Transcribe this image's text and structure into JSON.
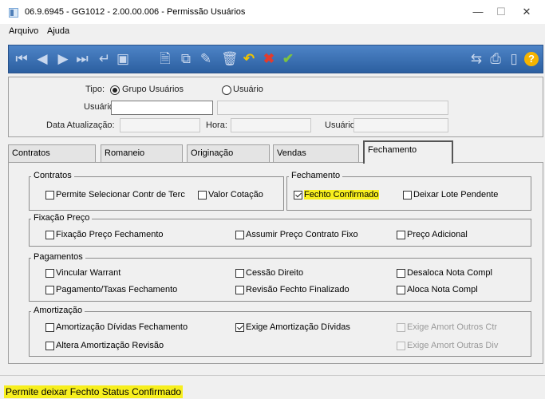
{
  "window": {
    "title": "06.9.6945 - GG1012 - 2.00.00.006 - Permissão Usuários",
    "minimize": "—",
    "maximize": "☐",
    "close": "✕"
  },
  "menu": [
    "Arquivo",
    "Ajuda"
  ],
  "toolbar": {
    "icons": [
      "first-record-icon",
      "prev-record-icon",
      "next-record-icon",
      "last-record-icon",
      "return-icon",
      "view-icon",
      "new-document-icon",
      "copy-icon",
      "edit-icon",
      "delete-icon",
      "undo-icon",
      "cancel-icon",
      "confirm-icon",
      "filter-icon",
      "print-icon",
      "exit-icon",
      "help-icon"
    ],
    "colors": {
      "undo": "#f0c300",
      "cancel": "#e43b2c",
      "confirm": "#7cc242",
      "help": "#f5b400"
    }
  },
  "header": {
    "tipo_label": "Tipo:",
    "radio_grupo": "Grupo Usuários",
    "radio_usuario": "Usuário",
    "radio_selected": "grupo",
    "usuario_label": "Usuário:",
    "usuario_value": "",
    "data_label": "Data Atualização:",
    "hora_label": "Hora:",
    "usuario2_label": "Usuário:"
  },
  "tabs": [
    {
      "label": "Contratos"
    },
    {
      "label": "Romaneio"
    },
    {
      "label": "Originação"
    },
    {
      "label": "Vendas"
    },
    {
      "label": "Fechamento",
      "active": true
    }
  ],
  "groups": {
    "contratos": {
      "title": "Contratos",
      "items": [
        {
          "label": "Permite Selecionar Contr de Terc",
          "checked": false
        },
        {
          "label": "Valor Cotação",
          "checked": false
        }
      ]
    },
    "fechamento": {
      "title": "Fechamento",
      "items": [
        {
          "label": "Fechto Confirmado",
          "checked": true,
          "highlight": true
        },
        {
          "label": "Deixar Lote Pendente",
          "checked": false
        }
      ]
    },
    "fixacao": {
      "title": "Fixação Preço",
      "items": [
        {
          "label": "Fixação Preço Fechamento",
          "checked": false
        },
        {
          "label": "Assumir Preço Contrato Fixo",
          "checked": false
        },
        {
          "label": "Preço Adicional",
          "checked": false
        }
      ]
    },
    "pagamentos": {
      "title": "Pagamentos",
      "items": [
        {
          "label": "Vincular Warrant",
          "checked": false
        },
        {
          "label": "Cessão Direito",
          "checked": false
        },
        {
          "label": "Desaloca Nota Compl",
          "checked": false
        },
        {
          "label": "Pagamento/Taxas Fechamento",
          "checked": false
        },
        {
          "label": "Revisão Fechto Finalizado",
          "checked": false
        },
        {
          "label": "Aloca Nota Compl",
          "checked": false
        }
      ]
    },
    "amortizacao": {
      "title": "Amortização",
      "items": [
        {
          "label": "Amortização Dívidas Fechamento",
          "checked": false
        },
        {
          "label": "Exige Amortização Dívidas",
          "checked": true
        },
        {
          "label": "Exige Amort Outros Ctr",
          "checked": false,
          "disabled": true
        },
        {
          "label": "Altera Amortização Revisão",
          "checked": false
        },
        {
          "label": "Exige Amort Outras Div",
          "checked": false,
          "disabled": true
        }
      ]
    }
  },
  "status": {
    "text": "Permite deixar Fechto Status Confirmado",
    "highlight_color": "#f7ef1e"
  }
}
